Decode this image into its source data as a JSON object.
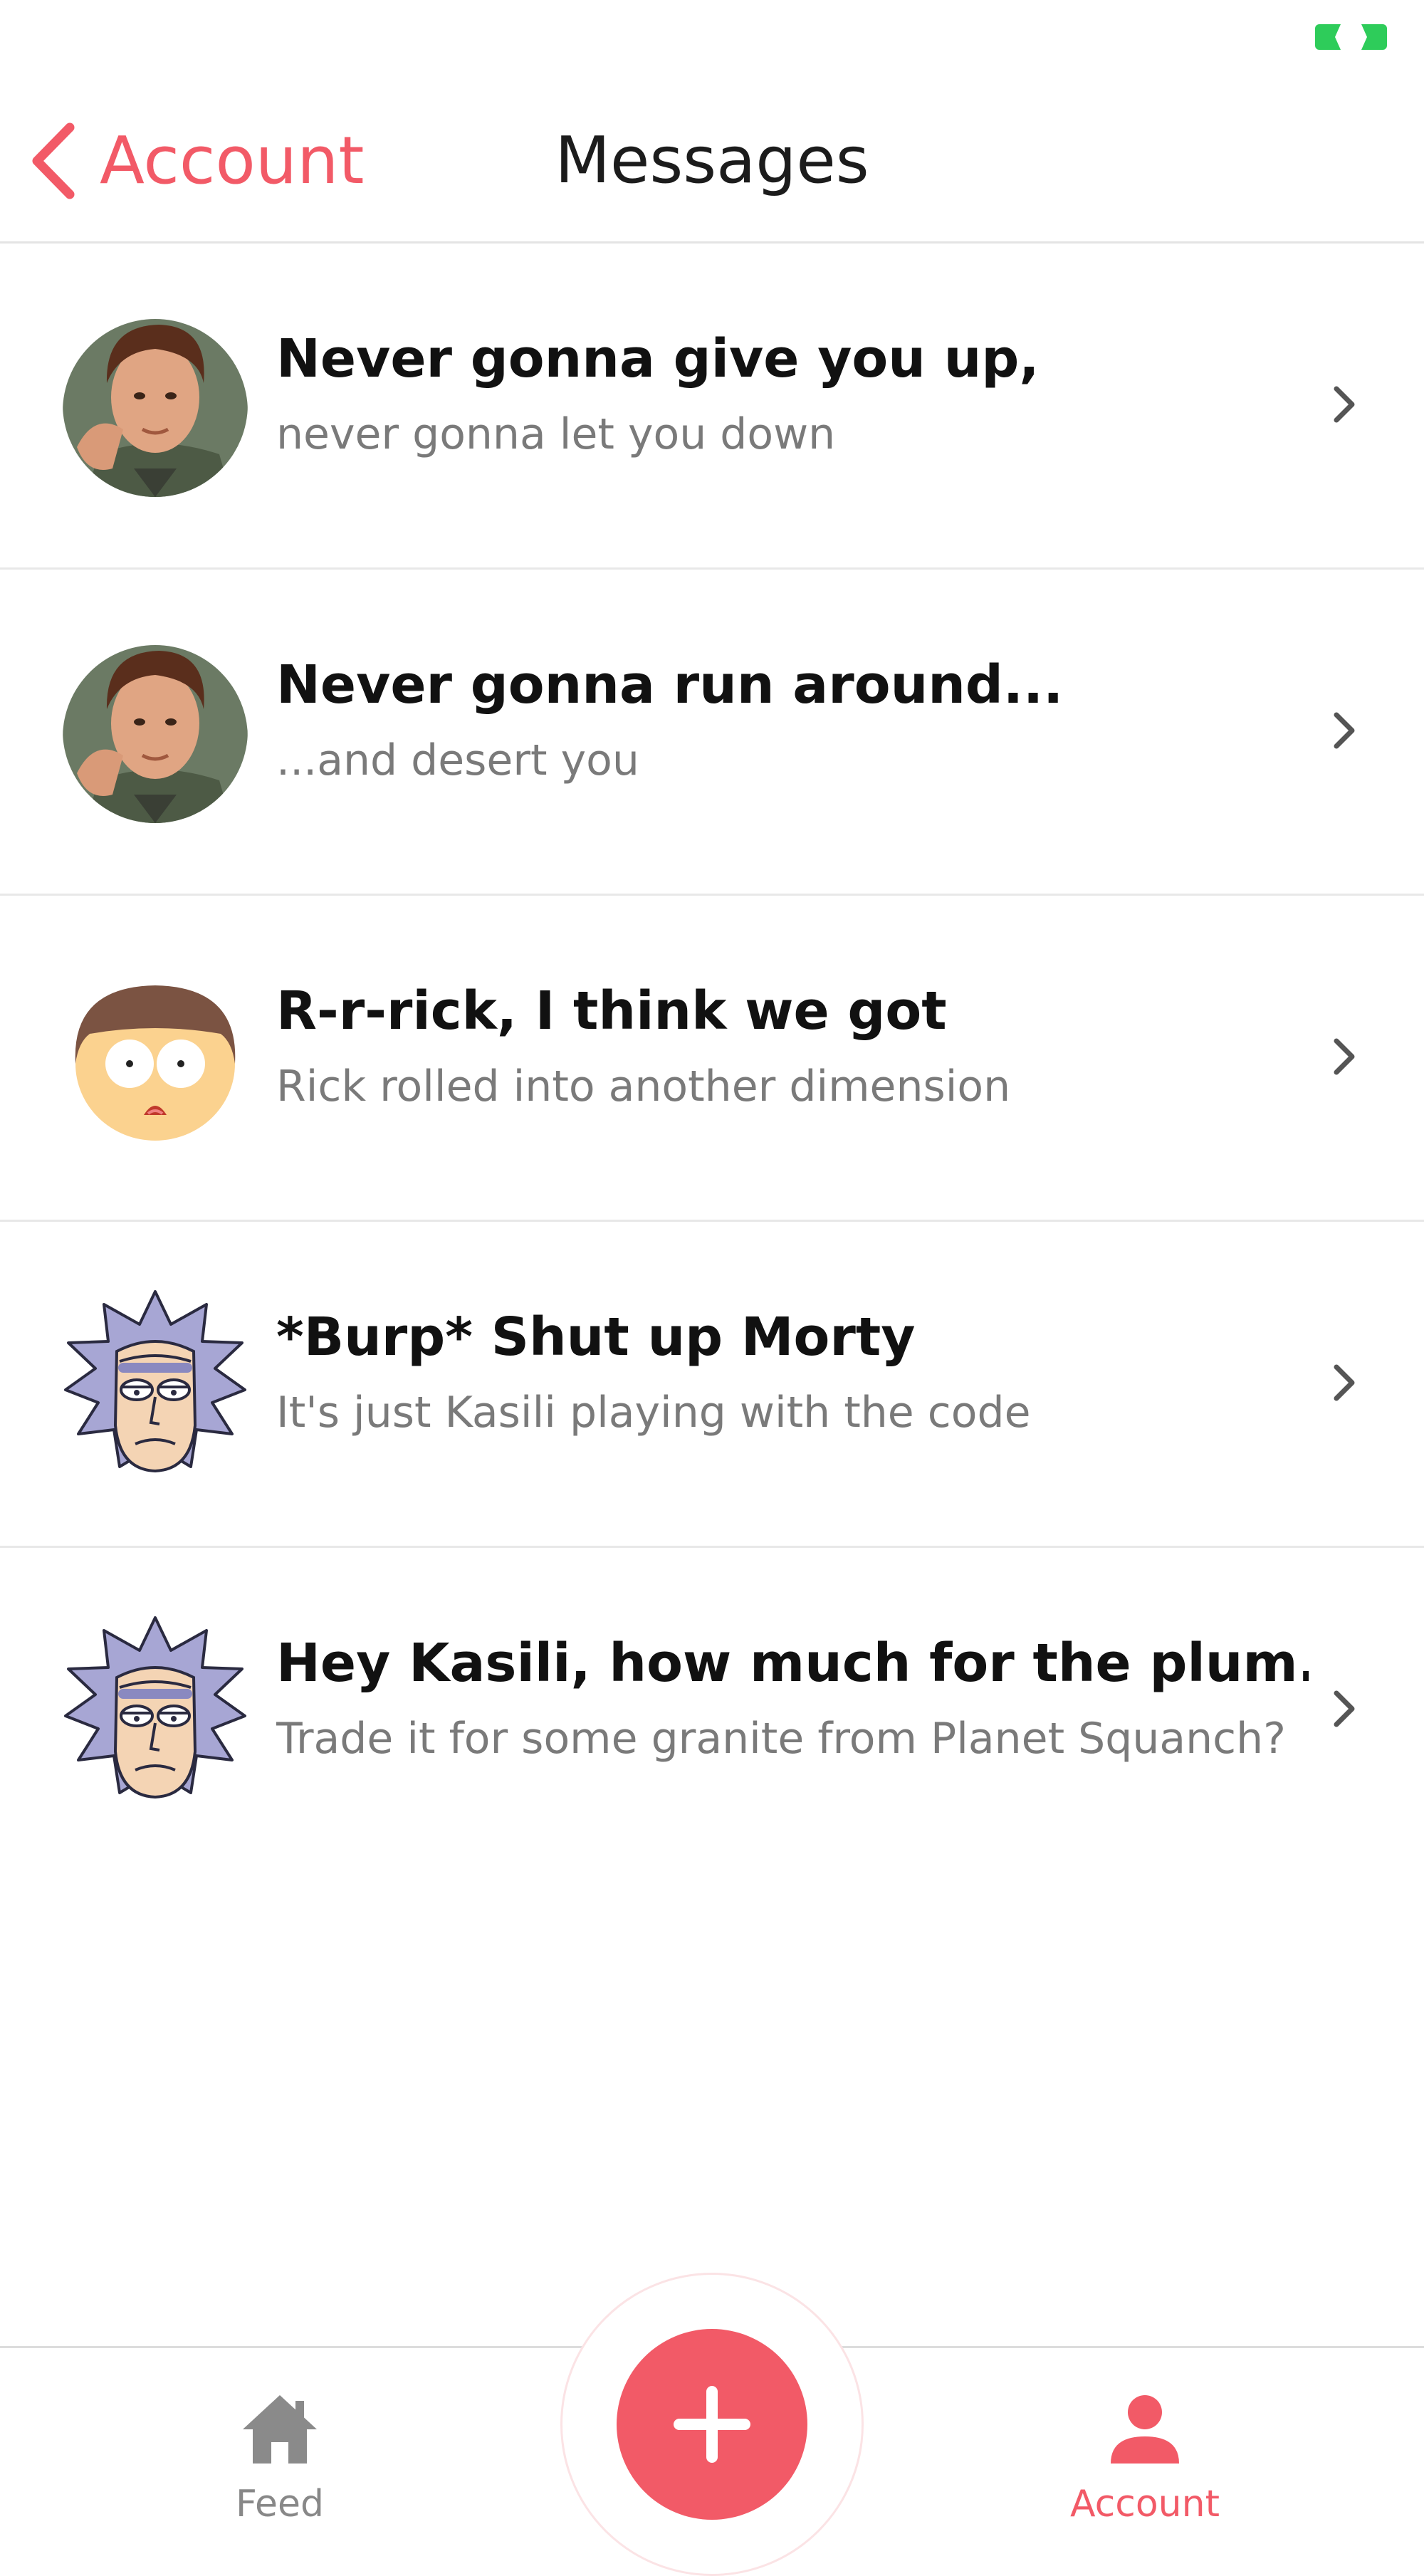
{
  "header": {
    "back_label": "Account",
    "title": "Messages"
  },
  "messages": [
    {
      "title": "Never gonna give you up,",
      "subtitle": "never gonna let you down",
      "avatar": "rick-astley-avatar"
    },
    {
      "title": "Never gonna run around...",
      "subtitle": "...and desert you",
      "avatar": "rick-astley-avatar"
    },
    {
      "title": "R-r-rick, I think we got",
      "subtitle": "Rick rolled into another dimension",
      "avatar": "morty-avatar"
    },
    {
      "title": "*Burp* Shut up Morty",
      "subtitle": "It's just Kasili playing with the code",
      "avatar": "rick-sanchez-avatar"
    },
    {
      "title": "Hey Kasili, how much for the plum...",
      "subtitle": "Trade it for some granite from Planet Squanch?",
      "avatar": "rick-sanchez-avatar"
    }
  ],
  "tabbar": {
    "feed_label": "Feed",
    "account_label": "Account",
    "active_tab": "Account"
  },
  "colors": {
    "accent": "#f25a67",
    "battery": "#2ecc5a",
    "inactive_tab": "#888888",
    "subtitle": "#7a7a7a"
  },
  "icons": {
    "back": "chevron-left-icon",
    "row": "chevron-right-icon",
    "feed": "home-icon",
    "account": "person-icon",
    "add": "plus-icon",
    "status": "battery-icon"
  }
}
